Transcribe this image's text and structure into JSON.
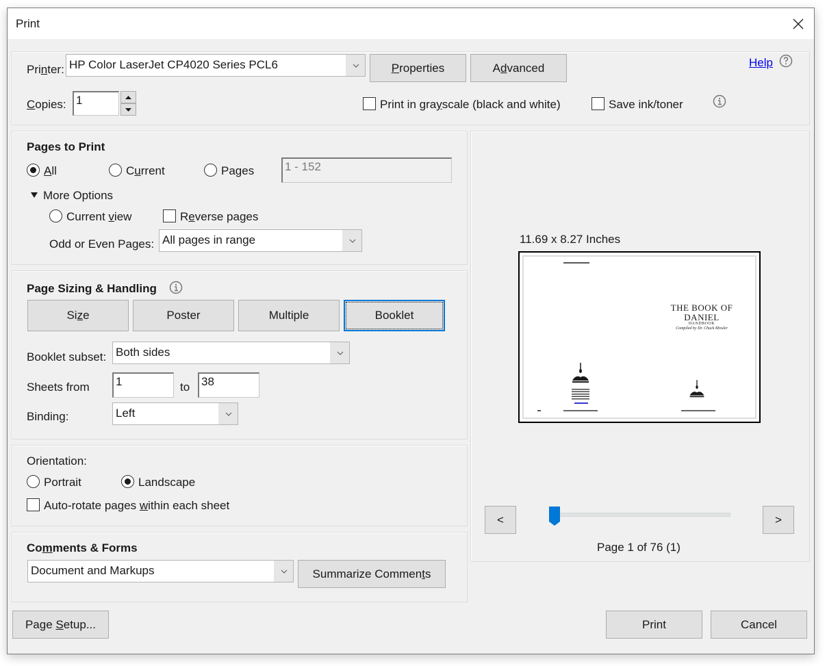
{
  "window": {
    "title": "Print"
  },
  "top": {
    "printer_label_pre": "Pri",
    "printer_label_u": "n",
    "printer_label_post": "ter:",
    "printer_value": "HP Color LaserJet CP4020 Series PCL6",
    "properties_pre": "",
    "properties_u": "P",
    "properties_post": "roperties",
    "advanced_pre": "A",
    "advanced_u": "d",
    "advanced_post": "vanced",
    "help_label": "Help",
    "copies_label_u": "C",
    "copies_label_post": "opies:",
    "copies_value": "1",
    "grayscale_pre": "Print in gra",
    "grayscale_u": "y",
    "grayscale_post": "scale (black and white)",
    "grayscale_checked": false,
    "save_ink_label": "Save ink/toner",
    "save_ink_checked": false
  },
  "pages_to_print": {
    "heading": "Pages to Print",
    "all_u": "A",
    "all_post": "ll",
    "current_pre": "C",
    "current_u": "u",
    "current_post": "rrent",
    "pages_pre": "Pa",
    "pages_u": "g",
    "pages_post": "es",
    "selected": "All",
    "pages_range": "1 - 152",
    "more_options": "More Options",
    "current_view_pre": "Current ",
    "current_view_u": "v",
    "current_view_post": "iew",
    "reverse_pre": "R",
    "reverse_u": "e",
    "reverse_post": "verse pages",
    "reverse_checked": false,
    "odd_even_label": "Odd or Even Pages:",
    "odd_even_value": "All pages in range"
  },
  "sizing": {
    "heading": "Page Sizing & Handling",
    "tabs": [
      {
        "pre": "Si",
        "u": "z",
        "post": "e"
      },
      {
        "pre": "Poster",
        "u": "",
        "post": ""
      },
      {
        "pre": "Multiple",
        "u": "",
        "post": ""
      },
      {
        "pre": "Booklet",
        "u": "",
        "post": ""
      }
    ],
    "selected_tab": "Booklet",
    "booklet_subset_label": "Booklet subset:",
    "booklet_subset_value": "Both sides",
    "sheets_from_label": "Sheets from",
    "sheets_from_value": "1",
    "to_label": "to",
    "sheets_to_value": "38",
    "binding_label": "Binding:",
    "binding_value": "Left"
  },
  "orientation": {
    "label": "Orientation:",
    "portrait": "Portrait",
    "landscape": "Landscape",
    "selected": "Landscape",
    "autorotate_pre": "Auto-rotate pages ",
    "autorotate_u": "w",
    "autorotate_post": "ithin each sheet",
    "autorotate_checked": false
  },
  "comments": {
    "heading_pre": "Co",
    "heading_u": "m",
    "heading_post": "ments & Forms",
    "value": "Document and Markups",
    "summarize_pre": "Summarize Commen",
    "summarize_u": "t",
    "summarize_post": "s"
  },
  "preview": {
    "size_label": "11.69 x 8.27 Inches",
    "doc_title_line1": "THE BOOK OF",
    "doc_title_line2": "DANIEL",
    "doc_subtitle": "HANDBOOK",
    "doc_author": "Compiled by Dr. Chuck Missler",
    "prev_label": "<",
    "next_label": ">",
    "page_status": "Page 1 of 76 (1)",
    "current_page": 1,
    "total_pages": 76,
    "accent_color": "#0078d7"
  },
  "footer": {
    "page_setup_pre": "Page ",
    "page_setup_u": "S",
    "page_setup_post": "etup...",
    "print_label": "Print",
    "cancel_label": "Cancel"
  }
}
